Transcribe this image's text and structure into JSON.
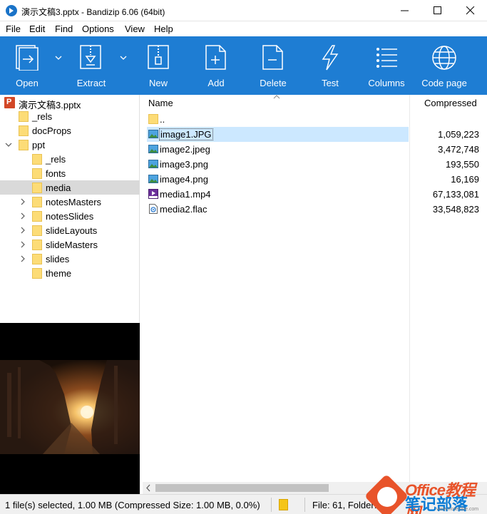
{
  "window": {
    "title": "演示文稿3.pptx - Bandizip 6.06 (64bit)"
  },
  "menu": [
    "File",
    "Edit",
    "Find",
    "Options",
    "View",
    "Help"
  ],
  "toolbar": {
    "open": "Open",
    "extract": "Extract",
    "new": "New",
    "add": "Add",
    "delete": "Delete",
    "test": "Test",
    "columns": "Columns",
    "codepage": "Code page"
  },
  "tree": {
    "root": "演示文稿3.pptx",
    "items": [
      {
        "label": "_rels"
      },
      {
        "label": "docProps"
      },
      {
        "label": "ppt"
      },
      {
        "label": "_rels"
      },
      {
        "label": "fonts"
      },
      {
        "label": "media"
      },
      {
        "label": "notesMasters"
      },
      {
        "label": "notesSlides"
      },
      {
        "label": "slideLayouts"
      },
      {
        "label": "slideMasters"
      },
      {
        "label": "slides"
      },
      {
        "label": "theme"
      }
    ]
  },
  "filelist": {
    "headers": {
      "name": "Name",
      "compressed": "Compressed"
    },
    "up": "..",
    "files": [
      {
        "name": "image1.JPG",
        "size": "1,059,223",
        "icon": "image-icon"
      },
      {
        "name": "image2.jpeg",
        "size": "3,472,748",
        "icon": "image-icon"
      },
      {
        "name": "image3.png",
        "size": "193,550",
        "icon": "image-icon"
      },
      {
        "name": "image4.png",
        "size": "16,169",
        "icon": "image-icon"
      },
      {
        "name": "media1.mp4",
        "size": "67,133,081",
        "icon": "video-icon"
      },
      {
        "name": "media2.flac",
        "size": "33,548,823",
        "icon": "audio-icon"
      }
    ]
  },
  "status": {
    "left": "1 file(s) selected, 1.00 MB (Compressed Size: 1.00 MB, 0.0%)",
    "right": "File: 61, Folder:"
  },
  "watermark": {
    "top": "Office教程网",
    "cn": "笔记部落",
    "url": "www.notetribe.com"
  },
  "colors": {
    "toolbar": "#1e7dd3",
    "selection": "#cce8ff",
    "folder": "#fcdc77"
  }
}
